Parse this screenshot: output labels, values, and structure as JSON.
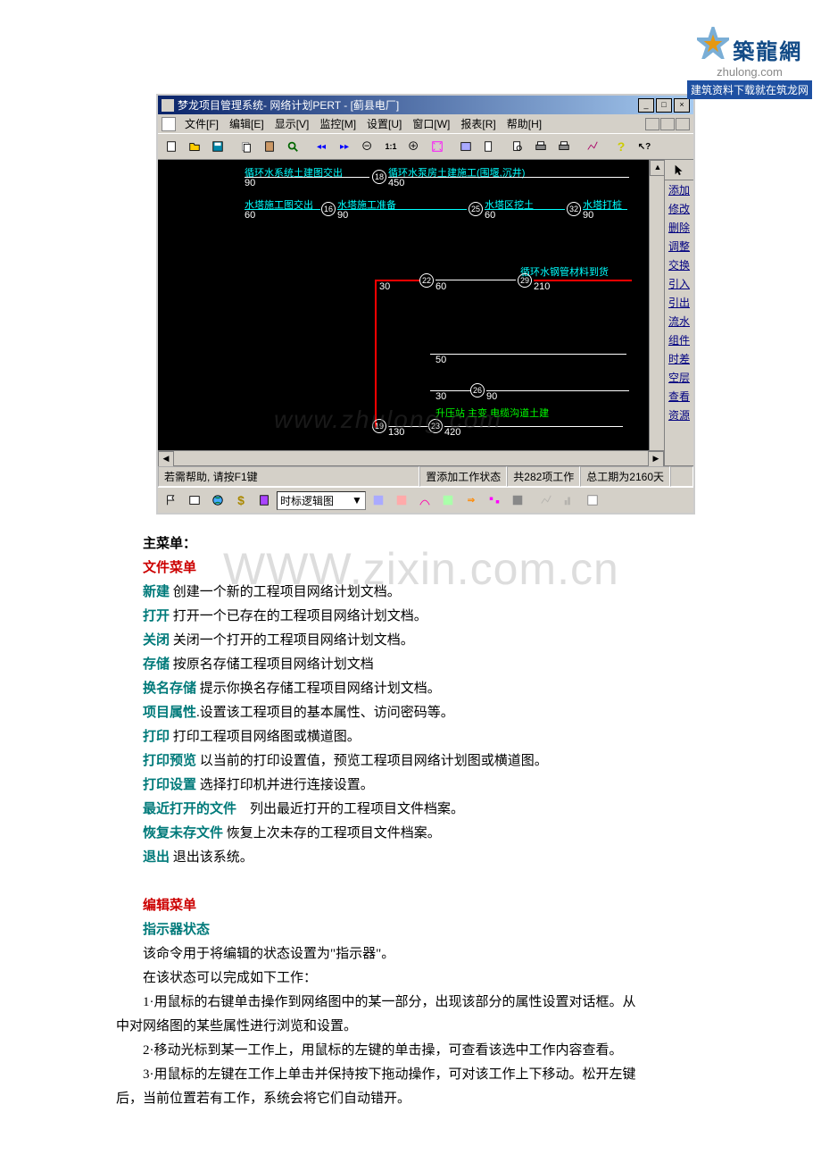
{
  "logo": {
    "cn": "築龍網",
    "en": "zhulong.com",
    "bar": "建筑资料下载就在筑龙网"
  },
  "app": {
    "title": "梦龙项目管理系统- 网络计划PERT - [蓟县电厂]",
    "menus": [
      "文件[F]",
      "编辑[E]",
      "显示[V]",
      "监控[M]",
      "设置[U]",
      "窗口[W]",
      "报表[R]",
      "帮助[H]"
    ],
    "sidebar_buttons": [
      "添加",
      "修改",
      "删除",
      "调整",
      "交换",
      "引入",
      "引出",
      "流水",
      "组件",
      "时差",
      "空层",
      "查看",
      "资源"
    ],
    "status": {
      "help": "若需帮助, 请按F1键",
      "mode": "置添加工作状态",
      "count": "共282项工作",
      "duration": "总工期为2160天"
    },
    "combo": "时标逻辑图",
    "canvas": {
      "labels": {
        "a": "循环水系统土建图交出",
        "a_top": "90",
        "b": "循环水泵房土建施工(围堰,沉井)",
        "b_bot": "450",
        "c": "水塔施工图交出",
        "c_top": "60",
        "d": "水塔施工准备",
        "d_bot": "90",
        "e": "水塔区挖土",
        "e_bot": "60",
        "f": "水塔打桩",
        "f_bot": "90",
        "g": "循环水钢管材料到货",
        "g_30": "30",
        "g_60": "60",
        "g_210": "210",
        "h50": "50",
        "h30": "30",
        "h90": "90",
        "i": "升压站 主变 电缆沟道土建",
        "i130": "130",
        "i420": "420"
      },
      "nodes": {
        "n18": "18",
        "n16": "16",
        "n25": "25",
        "n32": "32",
        "n22": "22",
        "n29": "29",
        "n26": "26",
        "n19": "19",
        "n23": "23"
      },
      "watermark": "www.zhulong.com"
    }
  },
  "doc": {
    "main_menu": "主菜单：",
    "file_menu": "文件菜单",
    "wm": "WWW.zixin.com.cn",
    "file_items": [
      {
        "cmd": "新建",
        "desc": " 创建一个新的工程项目网络计划文档。"
      },
      {
        "cmd": "打开",
        "desc": " 打开一个已存在的工程项目网络计划文档。"
      },
      {
        "cmd": "关闭",
        "desc": " 关闭一个打开的工程项目网络计划文档。"
      },
      {
        "cmd": "存储",
        "desc": " 按原名存储工程项目网络计划文档"
      },
      {
        "cmd": "换名存储",
        "desc": " 提示你换名存储工程项目网络计划文档。"
      },
      {
        "cmd": "项目属性",
        "desc": ".设置该工程项目的基本属性、访问密码等。"
      },
      {
        "cmd": "打印",
        "desc": " 打印工程项目网络图或横道图。"
      },
      {
        "cmd": "打印预览",
        "desc": " 以当前的打印设置值，预览工程项目网络计划图或横道图。"
      },
      {
        "cmd": "打印设置",
        "desc": " 选择打印机并进行连接设置。"
      },
      {
        "cmd": "最近打开的文件",
        "desc": "　列出最近打开的工程项目文件档案。"
      },
      {
        "cmd": "恢复未存文件",
        "desc": " 恢复上次未存的工程项目文件档案。"
      },
      {
        "cmd": "退出",
        "desc": " 退出该系统。"
      }
    ],
    "edit_menu": "编辑菜单",
    "indicator": "指示器状态",
    "edit_paras": [
      "该命令用于将编辑的状态设置为\"指示器\"。",
      "在该状态可以完成如下工作：",
      "1·用鼠标的右键单击操作到网络图中的某一部分，出现该部分的属性设置对话框。从中对网络图的某些属性进行浏览和设置。",
      "2·移动光标到某一工作上，用鼠标的左键的单击操，可查看该选中工作内容查看。",
      "3·用鼠标的左键在工作上单击并保持按下拖动操作，可对该工作上下移动。松开左键后，当前位置若有工作，系统会将它们自动错开。"
    ]
  }
}
